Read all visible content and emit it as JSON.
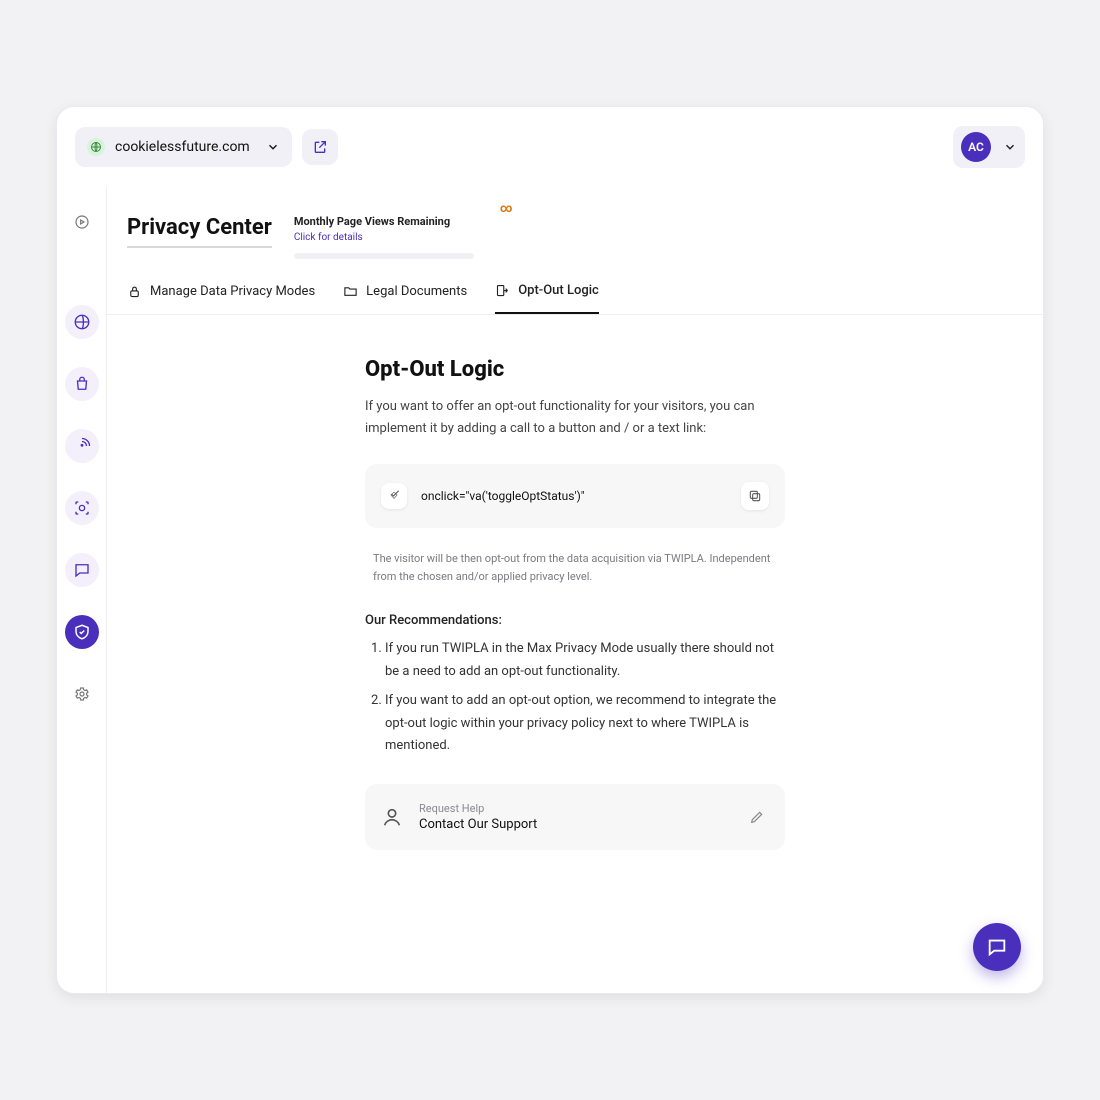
{
  "topbar": {
    "domain": "cookielessfuture.com",
    "user_initials": "AC"
  },
  "page": {
    "title": "Privacy Center",
    "quota": {
      "label": "Monthly Page Views Remaining",
      "details_link": "Click for details",
      "infinity": "∞"
    }
  },
  "tabs": [
    {
      "label": "Manage Data Privacy Modes"
    },
    {
      "label": "Legal Documents"
    },
    {
      "label": "Opt-Out Logic"
    }
  ],
  "content": {
    "heading": "Opt-Out Logic",
    "lead": "If you want to offer an opt-out functionality for your visitors, you can implement it by adding a call to a button and / or a text link:",
    "code": "onclick=\"va('toggleOptStatus')\"",
    "note": "The visitor will be then opt-out from the data acquisition via TWIPLA. Independent from the chosen and/or applied privacy level.",
    "recs_title": "Our Recommendations:",
    "recs": [
      "If you run TWIPLA in the Max Privacy Mode usually there should not be a need to add an opt-out functionality.",
      "If you want to add an opt-out option, we recommend to integrate the opt-out logic within your privacy policy next to where TWIPLA is mentioned."
    ],
    "support": {
      "kicker": "Request Help",
      "main": "Contact Our Support"
    }
  }
}
